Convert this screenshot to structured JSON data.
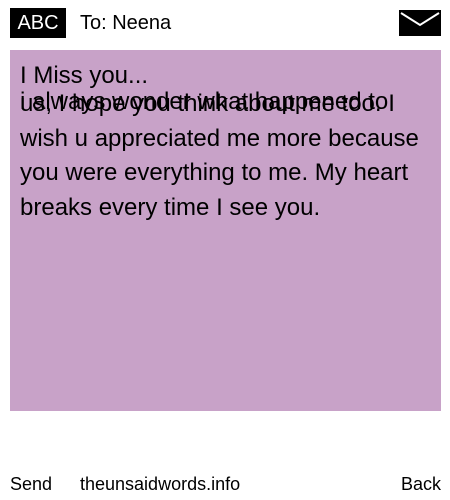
{
  "header": {
    "mode_label": "ABC",
    "recipient": "To: Neena",
    "mail_icon": "envelope-icon"
  },
  "message": {
    "line1": "I Miss you...",
    "overlap_line": "i always wonder what happened to",
    "body": "us, I hope you think about me too. I wish u appreciated me more because you were everything to me. My heart breaks every time I see you.",
    "background_color": "#c8a2c8"
  },
  "footer": {
    "send_label": "Send",
    "site": "theunsaidwords.info",
    "back_label": "Back"
  }
}
